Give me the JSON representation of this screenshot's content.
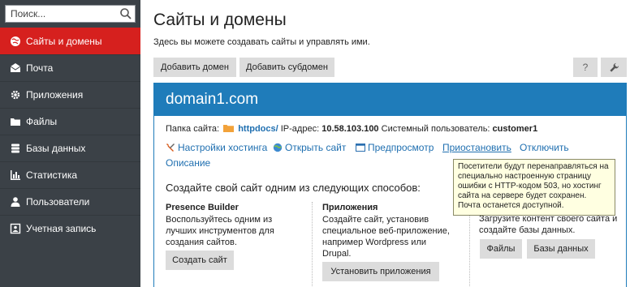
{
  "sidebar": {
    "search_placeholder": "Поиск...",
    "items": [
      {
        "label": "Сайты и домены",
        "icon": "globe-icon",
        "active": true
      },
      {
        "label": "Почта",
        "icon": "mail-icon"
      },
      {
        "label": "Приложения",
        "icon": "gear-icon"
      },
      {
        "label": "Файлы",
        "icon": "folder-icon"
      },
      {
        "label": "Базы данных",
        "icon": "database-icon"
      },
      {
        "label": "Статистика",
        "icon": "bar-chart-icon"
      },
      {
        "label": "Пользователи",
        "icon": "users-icon"
      },
      {
        "label": "Учетная запись",
        "icon": "account-icon"
      }
    ]
  },
  "header": {
    "title": "Сайты и домены",
    "description": "Здесь вы можете создавать сайты и управлять ими."
  },
  "toolbar": {
    "add_domain": "Добавить домен",
    "add_subdomain": "Добавить субдомен",
    "help": "?"
  },
  "domain": {
    "name": "domain1.com",
    "folder_label": "Папка сайта:",
    "folder_value": "httpdocs/",
    "ip_label": "IP-адрес:",
    "ip_value": "10.58.103.100",
    "user_label": "Системный пользователь:",
    "user_value": "customer1",
    "actions": {
      "hosting_settings": "Настройки хостинга",
      "open_site": "Открыть сайт",
      "preview": "Предпросмотр",
      "suspend": "Приостановить",
      "disable": "Отключить",
      "description": "Описание"
    }
  },
  "create": {
    "title": "Создайте свой сайт одним из следующих способов:",
    "presence": {
      "heading": "Presence Builder",
      "text": "Воспользуйтесь одним из лучших инструментов для создания сайтов.",
      "button": "Создать сайт"
    },
    "apps": {
      "heading": "Приложения",
      "text": "Создайте сайт, установив специальное веб-приложение, например Wordpress или Drupal.",
      "button": "Установить приложения"
    },
    "content": {
      "text": "Загрузите контент своего сайта и создайте базы данных.",
      "files_button": "Файлы",
      "db_button": "Базы данных"
    }
  },
  "tooltip": {
    "text": "Посетители будут перенаправляться на специально настроенную страницу ошибки с HTTP-кодом 503, но хостинг сайта на сервере будет сохранен. Почта останется доступной."
  },
  "colors": {
    "sidebar_bg": "#3b4147",
    "active_red": "#d6201e",
    "panel_blue": "#1f7cba",
    "link_blue": "#1f6fb0",
    "tooltip_bg": "#ffffe1"
  }
}
